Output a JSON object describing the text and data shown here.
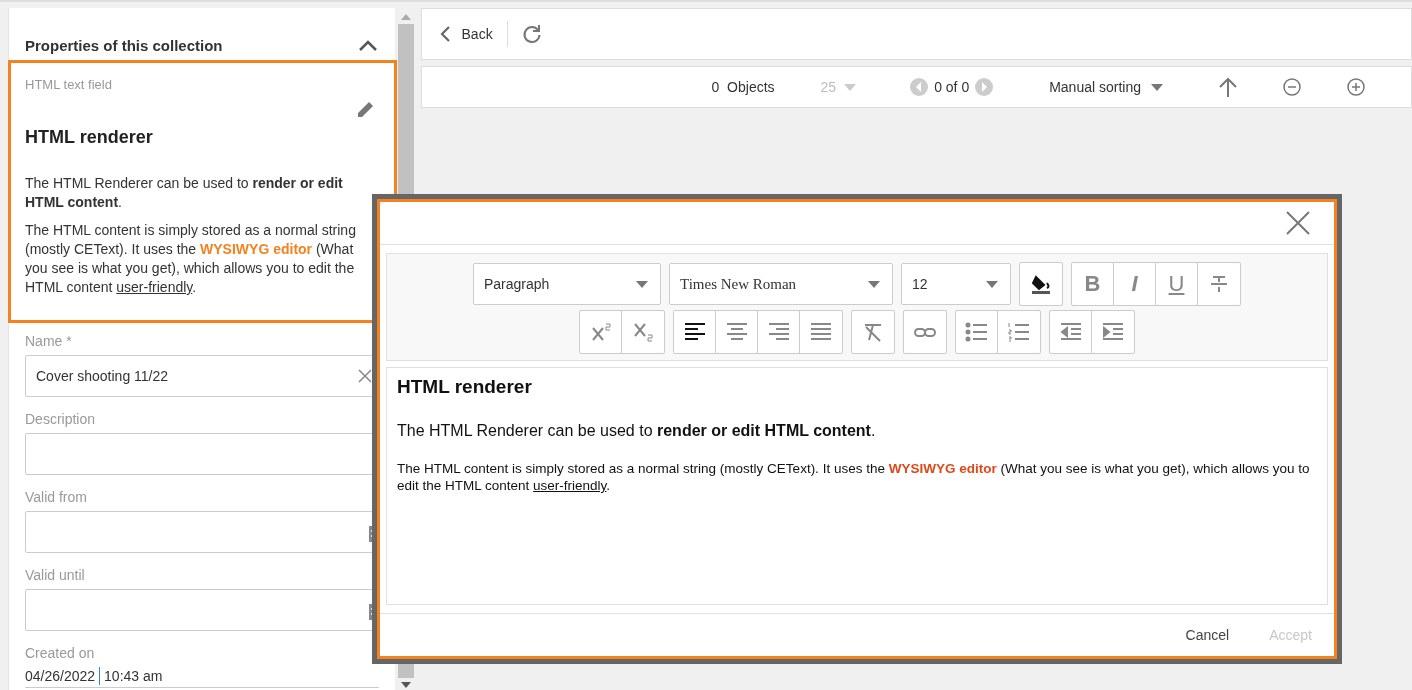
{
  "panel": {
    "title": "Properties of this collection",
    "expanded": true,
    "html_field": {
      "label": "HTML text field",
      "heading": "HTML renderer",
      "paragraphs": [
        [
          {
            "kind": "plain",
            "text": "The HTML Renderer can be used to "
          },
          {
            "kind": "bold",
            "text": "render or edit HTML content"
          },
          {
            "kind": "plain",
            "text": "."
          }
        ],
        [
          {
            "kind": "plain",
            "text": "The HTML content is simply stored as a normal string (mostly CEText). It uses the "
          },
          {
            "kind": "highlight",
            "text": "WYSIWYG editor"
          },
          {
            "kind": "plain",
            "text": " (What you see is what you get), which allows you to edit the HTML content "
          },
          {
            "kind": "underline",
            "text": "user-friendly"
          },
          {
            "kind": "plain",
            "text": "."
          }
        ]
      ]
    },
    "fields": [
      {
        "kind": "text",
        "label": "Name *",
        "value": "Cover shooting 11/22"
      },
      {
        "kind": "text",
        "label": "Description"
      },
      {
        "kind": "date",
        "label": "Valid from"
      },
      {
        "kind": "date",
        "label": "Valid until"
      },
      {
        "kind": "readonly",
        "label": "Created on",
        "date": "04/26/2022",
        "time": "10:43 am"
      }
    ]
  },
  "toolbar": {
    "back": "Back"
  },
  "pager": {
    "count": "0",
    "count_label": "Objects",
    "page_size": "25",
    "page_size_disabled": true,
    "pages": "0 of 0",
    "sort": "Manual sorting"
  },
  "editor": {
    "format": "Paragraph",
    "font": "Times New Roman",
    "size": "12",
    "tool_groups": [
      [
        {
          "kind": "fill",
          "selected": false
        }
      ],
      [
        {
          "kind": "bold",
          "label": "B",
          "selected": false
        },
        {
          "kind": "italic",
          "label": "I",
          "selected": false
        },
        {
          "kind": "underline",
          "label": "U",
          "selected": false
        },
        {
          "kind": "strike",
          "selected": false
        }
      ],
      [
        {
          "kind": "superscript",
          "selected": false
        },
        {
          "kind": "subscript",
          "selected": false
        }
      ],
      [
        {
          "kind": "align-left",
          "selected": true
        },
        {
          "kind": "align-center",
          "selected": false
        },
        {
          "kind": "align-right",
          "selected": false
        },
        {
          "kind": "justify",
          "selected": false
        }
      ],
      [
        {
          "kind": "clear-format",
          "selected": false
        }
      ],
      [
        {
          "kind": "link",
          "selected": false
        }
      ],
      [
        {
          "kind": "bullets",
          "selected": false
        },
        {
          "kind": "numbers",
          "selected": false
        }
      ],
      [
        {
          "kind": "outdent",
          "selected": false
        },
        {
          "kind": "indent",
          "selected": false
        }
      ]
    ],
    "content": {
      "heading": "HTML renderer",
      "paragraphs": [
        [
          {
            "kind": "plain",
            "text": "The HTML Renderer can be used to "
          },
          {
            "kind": "bold",
            "text": "render or edit HTML content"
          },
          {
            "kind": "plain",
            "text": "."
          }
        ],
        [
          {
            "kind": "plain",
            "text": "The HTML content is simply stored as a normal string (mostly CEText). It uses the "
          },
          {
            "kind": "highlight",
            "text": "WYSIWYG editor"
          },
          {
            "kind": "plain",
            "text": " (What you see is what you get), which allows you to edit the HTML content "
          },
          {
            "kind": "underline",
            "text": "user-friendly"
          },
          {
            "kind": "plain",
            "text": "."
          }
        ]
      ]
    },
    "cancel": "Cancel",
    "accept": "Accept",
    "accept_disabled": true
  }
}
